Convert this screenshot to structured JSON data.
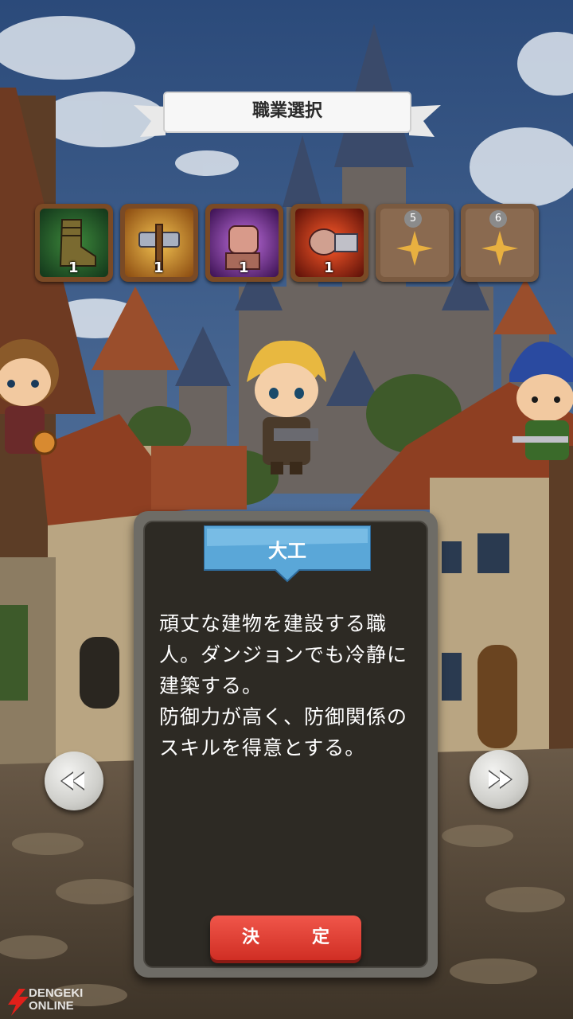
{
  "screen": {
    "title": "職業選択"
  },
  "skill_slots": [
    {
      "icon": "boot-icon",
      "count": "1"
    },
    {
      "icon": "hammer-icon",
      "count": "1"
    },
    {
      "icon": "fist-icon",
      "count": "1"
    },
    {
      "icon": "punch-icon",
      "count": "1"
    },
    {
      "icon": "locked-star-icon",
      "number": "5"
    },
    {
      "icon": "locked-star-icon",
      "number": "6"
    }
  ],
  "job": {
    "name": "大工",
    "description_lines": [
      "頑丈な建物を建設する職",
      "人。ダンジョンでも冷静に",
      "建築する。",
      "防御力が高く、防御関係の",
      "スキルを得意とする。"
    ]
  },
  "buttons": {
    "confirm": "決　定"
  },
  "watermark": {
    "line1": "DENGEKI",
    "line2": "ONLINE"
  },
  "colors": {
    "confirm": "#e0392f",
    "banner": "#5aa7d8",
    "panel": "#2d2a24"
  }
}
